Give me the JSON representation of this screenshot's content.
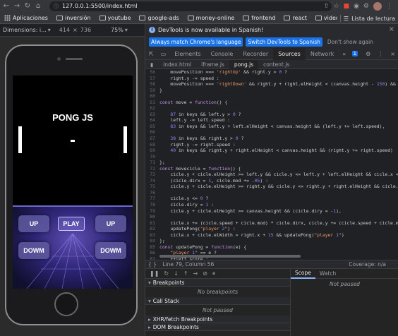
{
  "browser": {
    "url": "127.0.0.1:5500/index.html",
    "bookmarks": [
      "Aplicaciones",
      "inversión",
      "youtube",
      "google-ads",
      "money-online",
      "frontend",
      "react",
      "videos",
      "cursos"
    ],
    "reading_list": "Lista de lectura"
  },
  "device_toolbar": {
    "dimensions_label": "Dimensions: i...",
    "width": "414",
    "height": "736",
    "zoom": "75%"
  },
  "game": {
    "title": "PONG JS",
    "buttons": {
      "up_left": "UP",
      "play": "PLAY",
      "up_right": "UP",
      "down_left": "DOWM",
      "down_right": "DOWM"
    }
  },
  "devtools": {
    "notice": "DevTools is now available in Spanish!",
    "btn_match": "Always match Chrome's language",
    "btn_switch": "Switch DevTools to Spanish",
    "btn_dont": "Don't show again",
    "tabs": [
      "Elements",
      "Console",
      "Recorder",
      "Sources",
      "Network"
    ],
    "active_tab": "Sources",
    "issue_count": "1",
    "files": [
      "index.html",
      "iframe.js",
      "pong.js",
      "content.js"
    ],
    "active_file": "pong.js",
    "status": "Line 79, Column 56",
    "coverage": "Coverage: n/a",
    "sections": {
      "breakpoints": "Breakpoints",
      "no_breakpoints": "No breakpoints",
      "call_stack": "Call Stack",
      "not_paused": "Not paused",
      "xhr": "XHR/fetch Breakpoints",
      "dom": "DOM Breakpoints"
    },
    "scope_tabs": [
      "Scope",
      "Watch"
    ],
    "scope_not_paused": "Not paused"
  },
  "code": [
    {
      "n": "56",
      "t": "    movePosition === 'rightUp' && right.y > 0 ?"
    },
    {
      "n": "57",
      "t": "    right.y -= speed :"
    },
    {
      "n": "58",
      "t": "    movePosition === 'rightDown' && right.y + right.elHeight < (canvas.height - 150) && (right.y"
    },
    {
      "n": "59",
      "t": "}"
    },
    {
      "n": "60",
      "t": ""
    },
    {
      "n": "61",
      "t": "const move = function() {"
    },
    {
      "n": "62",
      "t": ""
    },
    {
      "n": "63",
      "t": "    87 in keys && left.y > 0 ?"
    },
    {
      "n": "64",
      "t": "    left.y -= left.speed :"
    },
    {
      "n": "65",
      "t": "    83 in keys && left.y + left.elHeight < canvas.height && (left.y += left.speed),"
    },
    {
      "n": "66",
      "t": ""
    },
    {
      "n": "67",
      "t": "    38 in keys && right.y > 0 ?"
    },
    {
      "n": "68",
      "t": "    right.y -= right.speed :"
    },
    {
      "n": "69",
      "t": "    40 in keys && right.y + right.elHeight < canvas.height && (right.y += right.speed)"
    },
    {
      "n": "70",
      "t": ""
    },
    {
      "n": "71",
      "t": "};"
    },
    {
      "n": "72",
      "t": "const movecicle = function() {"
    },
    {
      "n": "73",
      "t": "    cicle.y + cicle.elHeight >= left.y && cicle.y <= left.y + left.elHeight && cicle.x <= left"
    },
    {
      "n": "74",
      "t": "    (cicle.dirx = 1, cicle.mod += .05) :"
    },
    {
      "n": "75",
      "t": "    cicle.y + cicle.elHeight >= right.y && cicle.y <= right.y + right.elHeight && cicle.x + cicl"
    },
    {
      "n": "76",
      "t": ""
    },
    {
      "n": "77",
      "t": "    cicle.y <= 0 ?"
    },
    {
      "n": "78",
      "t": "    cicle.diry = 1 :"
    },
    {
      "n": "79",
      "t": "    cicle.y + cicle.elHeight >= canvas.height && (cicle.diry = -1),"
    },
    {
      "n": "80",
      "t": ""
    },
    {
      "n": "81",
      "t": "    cicle.x += (cicle.speed + cicle.mod) * cicle.dirx, cicle.y += (cicle.speed + cicle.mod) * ci"
    },
    {
      "n": "82",
      "t": "    updatePong(\"player 2\") :"
    },
    {
      "n": "83",
      "t": "    cicle.x + cicle.elWidth > right.x + 15 && updatePong(\"player 1\")"
    },
    {
      "n": "84",
      "t": "};"
    },
    {
      "n": "85",
      "t": "const updatePong = function(e) {"
    },
    {
      "n": "86",
      "t": "    \"player 1\" == e ?"
    },
    {
      "n": "87",
      "t": "    ++left.score :"
    },
    {
      "n": "88",
      "t": "    ++right.score,"
    },
    {
      "n": "89",
      "t": ""
    },
    {
      "n": "90",
      "t": "    left.y = canvas.height / 2 - left.elHeight / 2,"
    },
    {
      "n": "91",
      "t": "    right.y = left.y,"
    },
    {
      "n": "92",
      "t": "    cicle.y = canvas.height / 2 - cicle.elHeight / 2,"
    }
  ]
}
